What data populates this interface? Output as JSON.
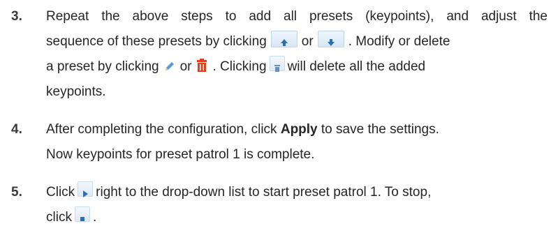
{
  "steps": [
    {
      "number": "3.",
      "l1": "Repeat the above steps to add all presets (keypoints), and adjust the",
      "l2a": "sequence of these presets by clicking",
      "l2b": "or",
      "l2c": ". Modify or delete",
      "l3a": "a preset by clicking",
      "l3b": "or",
      "l3c": ". Clicking",
      "l3d": "will delete all the added",
      "l4": "keypoints."
    },
    {
      "number": "4.",
      "l1a": "After completing the configuration, click",
      "l1b": "Apply",
      "l1c": "to save the settings.",
      "l2": "Now keypoints for preset patrol 1 is complete."
    },
    {
      "number": "5.",
      "l1a": "Click",
      "l1b": "right to the drop-down list to start preset patrol 1. To stop,",
      "l2a": "click",
      "l2b": "."
    }
  ],
  "icons": {
    "move_up": "arrow-up-icon",
    "move_down": "arrow-down-icon",
    "modify": "pencil-icon",
    "delete": "trash-icon",
    "delete_all": "trash-all-icon",
    "start": "play-icon",
    "stop": "stop-icon"
  },
  "colors": {
    "text": "#262626",
    "icon_blue": "#3d7fc1",
    "trash_red": "#e0401a"
  }
}
